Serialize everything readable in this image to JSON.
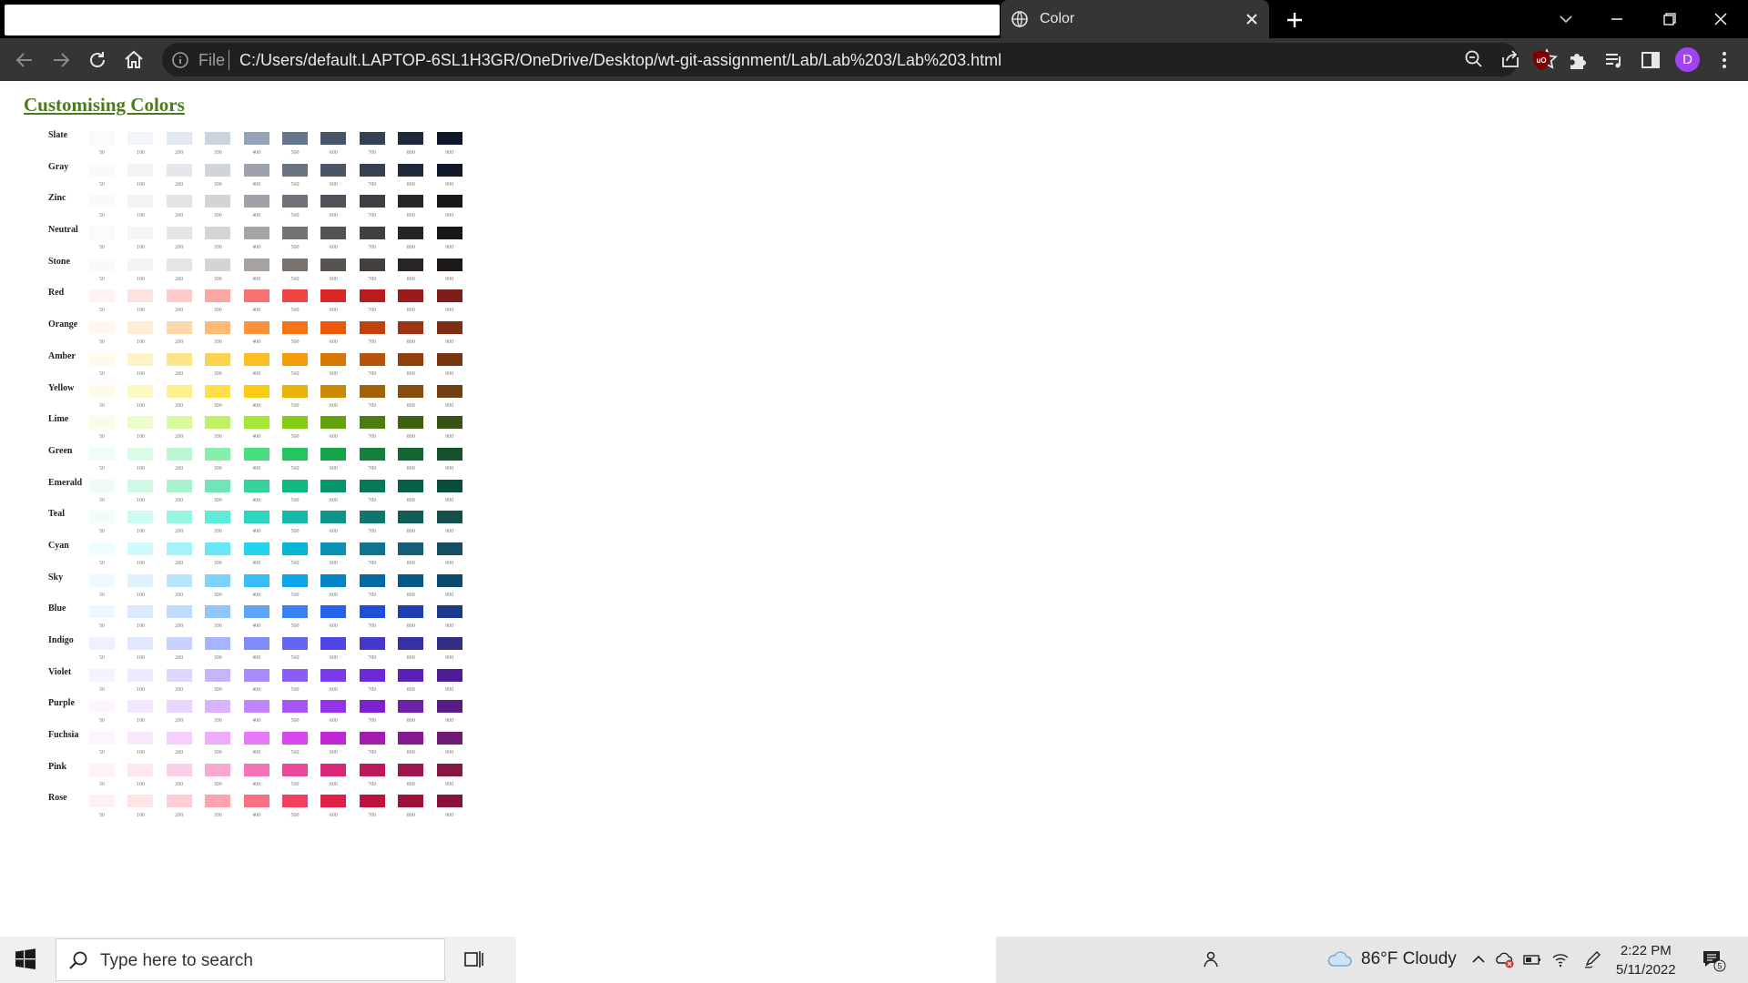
{
  "browser": {
    "tab_title": "Color",
    "url_scheme_label": "File",
    "url": "C:/Users/default.LAPTOP-6SL1H3GR/OneDrive/Desktop/wt-git-assignment/Lab/Lab%203/Lab%203.html",
    "profile_initial": "D",
    "icons": [
      "globe-icon",
      "close-icon",
      "plus-icon",
      "chevron-down-icon",
      "minimize-icon",
      "restore-icon",
      "back-icon",
      "forward-icon",
      "reload-icon",
      "home-icon",
      "info-icon",
      "zoom-icon",
      "share-icon",
      "star-icon",
      "ublock-icon",
      "extensions-icon",
      "media-icon",
      "side-panel-icon",
      "menu-icon"
    ]
  },
  "page": {
    "title": "Customising Colors",
    "shade_labels": [
      "50",
      "100",
      "200",
      "300",
      "400",
      "500",
      "600",
      "700",
      "800",
      "900"
    ],
    "palettes": [
      {
        "name": "Slate",
        "colors": [
          "#f8fafc",
          "#f1f5f9",
          "#e2e8f0",
          "#cbd5e1",
          "#94a3b8",
          "#64748b",
          "#475569",
          "#334155",
          "#1e293b",
          "#0f172a"
        ]
      },
      {
        "name": "Gray",
        "colors": [
          "#f9fafb",
          "#f3f4f6",
          "#e5e7eb",
          "#d1d5db",
          "#9ca3af",
          "#6b7280",
          "#4b5563",
          "#374151",
          "#1f2937",
          "#111827"
        ]
      },
      {
        "name": "Zinc",
        "colors": [
          "#fafafa",
          "#f4f4f5",
          "#e4e4e7",
          "#d4d4d8",
          "#a1a1aa",
          "#71717a",
          "#52525b",
          "#3f3f46",
          "#27272a",
          "#18181b"
        ]
      },
      {
        "name": "Neutral",
        "colors": [
          "#fafafa",
          "#f5f5f5",
          "#e5e5e5",
          "#d4d4d4",
          "#a3a3a3",
          "#737373",
          "#525252",
          "#404040",
          "#262626",
          "#171717"
        ]
      },
      {
        "name": "Stone",
        "colors": [
          "#fafaf9",
          "#f5f5f4",
          "#e7e5e4",
          "#d6d3d1",
          "#a8a29e",
          "#78716c",
          "#57534e",
          "#44403c",
          "#292524",
          "#1c1917"
        ]
      },
      {
        "name": "Red",
        "colors": [
          "#fef2f2",
          "#fee2e2",
          "#fecaca",
          "#fca5a5",
          "#f87171",
          "#ef4444",
          "#dc2626",
          "#b91c1c",
          "#991b1b",
          "#7f1d1d"
        ]
      },
      {
        "name": "Orange",
        "colors": [
          "#fff7ed",
          "#ffedd5",
          "#fed7aa",
          "#fdba74",
          "#fb923c",
          "#f97316",
          "#ea580c",
          "#c2410c",
          "#9a3412",
          "#7c2d12"
        ]
      },
      {
        "name": "Amber",
        "colors": [
          "#fffbeb",
          "#fef3c7",
          "#fde68a",
          "#fcd34d",
          "#fbbf24",
          "#f59e0b",
          "#d97706",
          "#b45309",
          "#92400e",
          "#78350f"
        ]
      },
      {
        "name": "Yellow",
        "colors": [
          "#fefce8",
          "#fef9c3",
          "#fef08a",
          "#fde047",
          "#facc15",
          "#eab308",
          "#ca8a04",
          "#a16207",
          "#854d0e",
          "#713f12"
        ]
      },
      {
        "name": "Lime",
        "colors": [
          "#f7fee7",
          "#ecfccb",
          "#d9f99d",
          "#bef264",
          "#a3e635",
          "#84cc16",
          "#65a30d",
          "#4d7c0f",
          "#3f6212",
          "#365314"
        ]
      },
      {
        "name": "Green",
        "colors": [
          "#f0fdf4",
          "#dcfce7",
          "#bbf7d0",
          "#86efac",
          "#4ade80",
          "#22c55e",
          "#16a34a",
          "#15803d",
          "#166534",
          "#14532d"
        ]
      },
      {
        "name": "Emerald",
        "colors": [
          "#ecfdf5",
          "#d1fae5",
          "#a7f3d0",
          "#6ee7b7",
          "#34d399",
          "#10b981",
          "#059669",
          "#047857",
          "#065f46",
          "#064e3b"
        ]
      },
      {
        "name": "Teal",
        "colors": [
          "#f0fdfa",
          "#ccfbf1",
          "#99f6e4",
          "#5eead4",
          "#2dd4bf",
          "#14b8a6",
          "#0d9488",
          "#0f766e",
          "#115e59",
          "#134e4a"
        ]
      },
      {
        "name": "Cyan",
        "colors": [
          "#ecfeff",
          "#cffafe",
          "#a5f3fc",
          "#67e8f9",
          "#22d3ee",
          "#06b6d4",
          "#0891b2",
          "#0e7490",
          "#155e75",
          "#164e63"
        ]
      },
      {
        "name": "Sky",
        "colors": [
          "#f0f9ff",
          "#e0f2fe",
          "#bae6fd",
          "#7dd3fc",
          "#38bdf8",
          "#0ea5e9",
          "#0284c7",
          "#0369a1",
          "#075985",
          "#0c4a6e"
        ]
      },
      {
        "name": "Blue",
        "colors": [
          "#eff6ff",
          "#dbeafe",
          "#bfdbfe",
          "#93c5fd",
          "#60a5fa",
          "#3b82f6",
          "#2563eb",
          "#1d4ed8",
          "#1e40af",
          "#1e3a8a"
        ]
      },
      {
        "name": "Indigo",
        "colors": [
          "#eef2ff",
          "#e0e7ff",
          "#c7d2fe",
          "#a5b4fc",
          "#818cf8",
          "#6366f1",
          "#4f46e5",
          "#4338ca",
          "#3730a3",
          "#312e81"
        ]
      },
      {
        "name": "Violet",
        "colors": [
          "#f5f3ff",
          "#ede9fe",
          "#ddd6fe",
          "#c4b5fd",
          "#a78bfa",
          "#8b5cf6",
          "#7c3aed",
          "#6d28d9",
          "#5b21b6",
          "#4c1d95"
        ]
      },
      {
        "name": "Purple",
        "colors": [
          "#faf5ff",
          "#f3e8ff",
          "#e9d5ff",
          "#d8b4fe",
          "#c084fc",
          "#a855f7",
          "#9333ea",
          "#7e22ce",
          "#6b21a8",
          "#581c87"
        ]
      },
      {
        "name": "Fuchsia",
        "colors": [
          "#fdf4ff",
          "#fae8ff",
          "#f5d0fe",
          "#f0abfc",
          "#e879f9",
          "#d946ef",
          "#c026d3",
          "#a21caf",
          "#86198f",
          "#701a75"
        ]
      },
      {
        "name": "Pink",
        "colors": [
          "#fdf2f8",
          "#fce7f3",
          "#fbcfe8",
          "#f9a8d4",
          "#f472b6",
          "#ec4899",
          "#db2777",
          "#be185d",
          "#9d174d",
          "#831843"
        ]
      },
      {
        "name": "Rose",
        "colors": [
          "#fff1f2",
          "#ffe4e6",
          "#fecdd3",
          "#fda4af",
          "#fb7185",
          "#f43f5e",
          "#e11d48",
          "#be123c",
          "#9f1239",
          "#881337"
        ]
      }
    ]
  },
  "taskbar": {
    "search_placeholder": "Type here to search",
    "weather": "86°F  Cloudy",
    "time": "2:22 PM",
    "date": "5/11/2022",
    "notification_count": "5",
    "icons": [
      "windows-start-icon",
      "search-icon",
      "task-view-icon",
      "people-icon",
      "cloud-icon",
      "chevron-up-icon",
      "onedrive-icon",
      "battery-icon",
      "wifi-icon",
      "pen-icon",
      "notification-icon"
    ]
  }
}
